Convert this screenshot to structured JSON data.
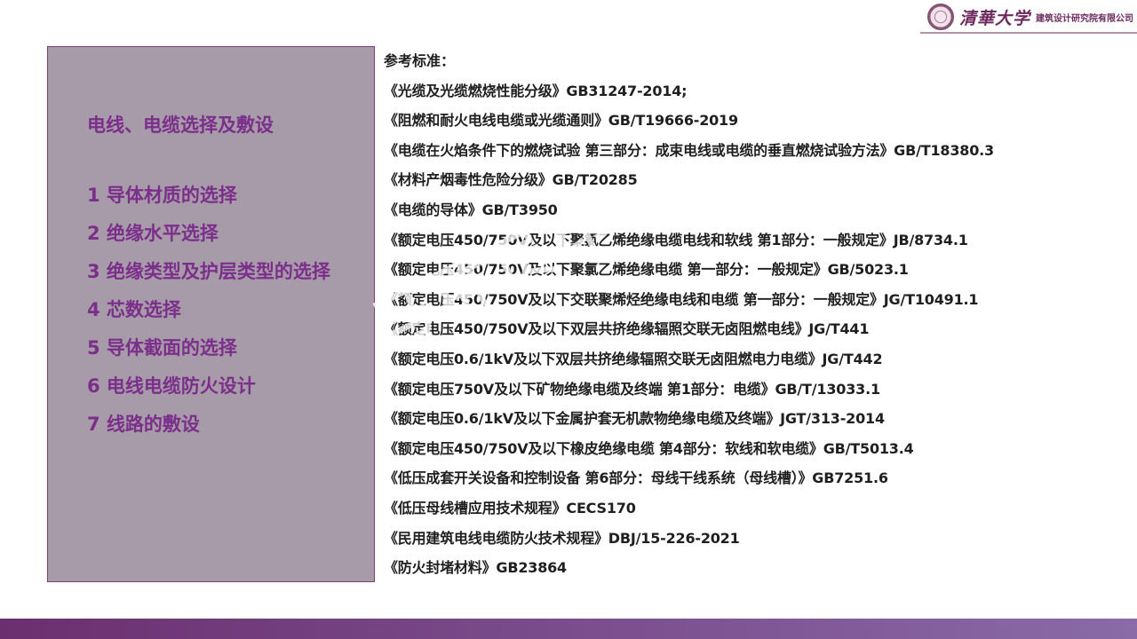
{
  "header": {
    "university": "清華大学",
    "institute": "建筑设计研究院有限公司"
  },
  "sidebar": {
    "title": "电线、电缆选择及敷设",
    "items": [
      {
        "label": "1 导体材质的选择"
      },
      {
        "label": "2 绝缘水平选择"
      },
      {
        "label": "3 绝缘类型及护层类型的选择"
      },
      {
        "label": "4 芯数选择"
      },
      {
        "label": "5 导体截面的选择"
      },
      {
        "label": "6 电线电缆防火设计"
      },
      {
        "label": "7 线路的敷设"
      }
    ]
  },
  "references": {
    "heading": "参考标准：",
    "items": [
      {
        "text": "《光缆及光缆燃烧性能分级》GB31247-2014;"
      },
      {
        "text": "《阻燃和耐火电线电缆或光缆通则》GB/T19666-2019"
      },
      {
        "text": "《电缆在火焰条件下的燃烧试验 第三部分：成束电线或电缆的垂直燃烧试验方法》GB/T18380.3"
      },
      {
        "text": "《材料产烟毒性危险分级》GB/T20285"
      },
      {
        "text": "《电缆的导体》GB/T3950"
      },
      {
        "text": "《额定电压450/750V及以下聚氯乙烯绝缘电缆电线和软线 第1部分：一般规定》JB/8734.1"
      },
      {
        "text": "《额定电压450/750V及以下聚氯乙烯绝缘电缆 第一部分：一般规定》GB/5023.1"
      },
      {
        "text": "《额定电压450/750V及以下交联聚烯烃绝缘电线和电缆 第一部分：一般规定》JG/T10491.1"
      },
      {
        "text": "《额定电压450/750V及以下双层共挤绝缘辐照交联无卤阻燃电线》JG/T441"
      },
      {
        "text": "《额定电压0.6/1kV及以下双层共挤绝缘辐照交联无卤阻燃电力电缆》JG/T442"
      },
      {
        "text": "《额定电压750V及以下矿物绝缘电缆及终端 第1部分：电缆》GB/T/13033.1"
      },
      {
        "text": "《额定电压0.6/1kV及以下金属护套无机款物绝缘电缆及终端》JGT/313-2014"
      },
      {
        "text": "《额定电压450/750V及以下橡皮绝缘电缆 第4部分：软线和软电缆》GB/T5013.4"
      },
      {
        "text": "《低压成套开关设备和控制设备 第6部分：母线干线系统（母线槽）》GB7251.6"
      },
      {
        "text": "《低压母线槽应用技术规程》CECS170"
      },
      {
        "text": "《民用建筑电线电缆防火技术规程》DBJ/15-226-2021"
      },
      {
        "text": "《防火封堵材料》GB23864"
      }
    ]
  },
  "watermark": {
    "text": "马群员印"
  }
}
